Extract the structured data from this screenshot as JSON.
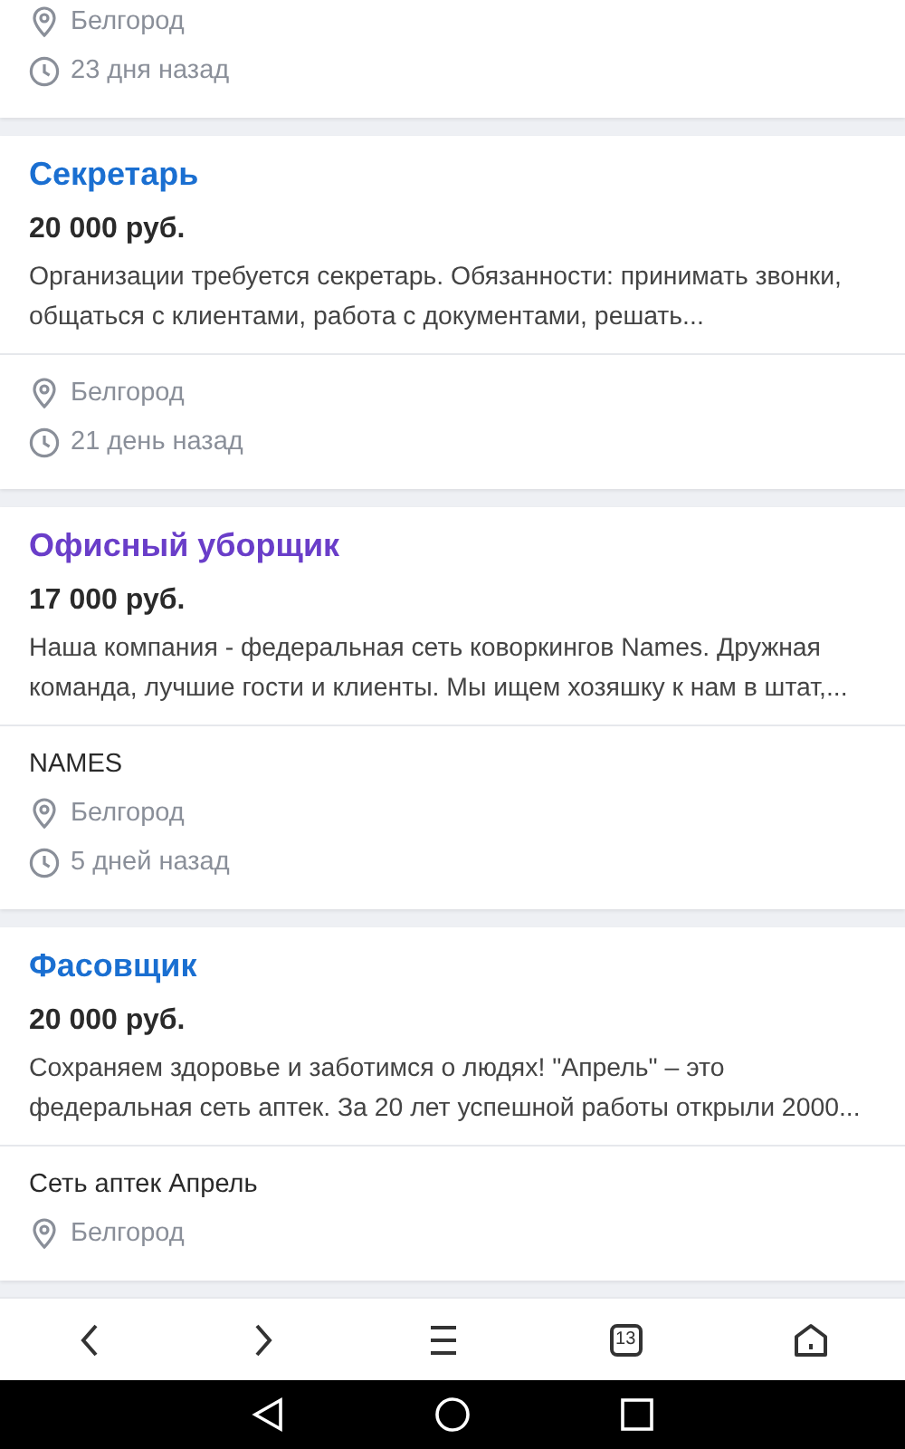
{
  "vacancies": [
    {
      "city": "Белгород",
      "posted": "23 дня назад"
    },
    {
      "title": "Секретарь",
      "visited": false,
      "salary": "20 000 руб.",
      "description": "Организации требуется секретарь. Обязанности: принимать звонки, общаться с клиентами, работа с документами, решать...",
      "city": "Белгород",
      "posted": "21 день назад"
    },
    {
      "title": "Офисный уборщик",
      "visited": true,
      "salary": "17 000 руб.",
      "description": "Наша компания - федеральная сеть коворкингов Names. Дружная команда, лучшие гости и клиенты. Мы ищем хозяшку к нам в штат,...",
      "company": "NAMES",
      "city": "Белгород",
      "posted": "5 дней назад"
    },
    {
      "title": "Фасовщик",
      "visited": false,
      "salary": "20 000 руб.",
      "description": "Сохраняем здоровье и заботимся о людях! \"Апрель\" – это федеральная сеть аптек. За 20 лет успешной работы открыли 2000...",
      "company": "Сеть аптек Апрель",
      "city": "Белгород"
    }
  ],
  "browser_toolbar": {
    "tab_count": "13"
  }
}
